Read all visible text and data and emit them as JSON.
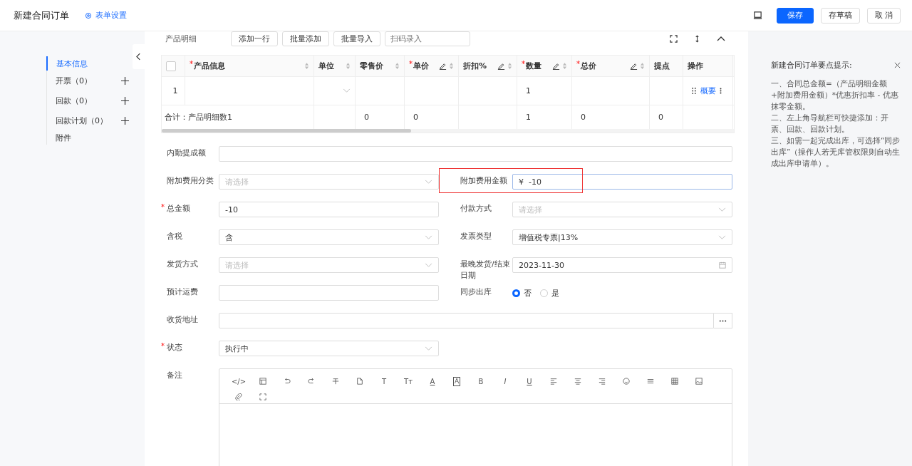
{
  "header": {
    "title": "新建合同订单",
    "settings_link": "表单设置",
    "buttons": [
      {
        "label": "保存",
        "kind": "primary"
      },
      {
        "label": "存草稿",
        "kind": "default"
      },
      {
        "label": "取 消",
        "kind": "default"
      }
    ]
  },
  "sidebar": {
    "items": [
      {
        "label": "基本信息",
        "addable": false,
        "selected": true
      },
      {
        "label": "开票",
        "count": "（0）",
        "addable": true,
        "selected": false
      },
      {
        "label": "回款",
        "count": "（0）",
        "addable": true,
        "selected": false
      },
      {
        "label": "回款计划",
        "count": "（0）",
        "addable": true,
        "selected": false
      },
      {
        "label": "附件",
        "addable": false,
        "selected": false
      }
    ]
  },
  "products": {
    "title": "产品明细",
    "select_all_checked": false,
    "buttons": [
      "添加一行",
      "批量添加",
      "批量导入"
    ],
    "scan_placeholder": "扫码录入",
    "columns": [
      {
        "label": "产品信息",
        "required": true,
        "editable": false,
        "sortable": true
      },
      {
        "label": "单位",
        "required": false,
        "editable": false,
        "sortable": true
      },
      {
        "label": "零售价",
        "required": false,
        "editable": false,
        "sortable": true
      },
      {
        "label": "单价",
        "required": true,
        "editable": true,
        "sortable": true
      },
      {
        "label": "折扣%",
        "required": false,
        "editable": true,
        "sortable": true
      },
      {
        "label": "数量",
        "required": true,
        "editable": true,
        "sortable": true
      },
      {
        "label": "总价",
        "required": true,
        "editable": true,
        "sortable": true
      },
      {
        "label": "提点",
        "required": false,
        "editable": false,
        "sortable": false
      },
      {
        "label": "操作",
        "required": false,
        "editable": false,
        "sortable": false
      }
    ],
    "rows": [
      {
        "index": "1",
        "cells": [
          "",
          "",
          "",
          "",
          "",
          "1",
          "",
          "",
          ""
        ],
        "action": "概要"
      }
    ],
    "summary": {
      "label": "合计：产品明细数1",
      "cells": [
        "",
        "0",
        "0",
        "",
        "1",
        "0",
        "0",
        ""
      ]
    }
  },
  "form": [
    {
      "label": "内勤提成额",
      "required": false,
      "kind": "text",
      "wide": true
    },
    {
      "label": "附加费用分类",
      "required": false,
      "kind": "select",
      "placeholder": "请选择"
    },
    {
      "label": "附加费用金额",
      "required": false,
      "kind": "money",
      "prefix": "¥",
      "value": "-10",
      "highlighted": true
    },
    {
      "label": "总金额",
      "required": true,
      "kind": "text",
      "value": "-10"
    },
    {
      "label": "付款方式",
      "required": false,
      "kind": "select",
      "placeholder": "请选择"
    },
    {
      "label": "含税",
      "required": false,
      "kind": "select",
      "value": "含"
    },
    {
      "label": "发票类型",
      "required": false,
      "kind": "select",
      "value": "增值税专票|13%"
    },
    {
      "label": "发货方式",
      "required": false,
      "kind": "select",
      "placeholder": "请选择"
    },
    {
      "label": "最晚发货/结束日期",
      "required": false,
      "kind": "date",
      "value": "2023-11-30"
    },
    {
      "label": "预计运费",
      "required": false,
      "kind": "text"
    },
    {
      "label": "同步出库",
      "required": false,
      "kind": "radio",
      "options": [
        {
          "label": "否",
          "selected": true
        },
        {
          "label": "是",
          "selected": false
        }
      ]
    },
    {
      "label": "收货地址",
      "required": false,
      "kind": "address",
      "wide": true
    },
    {
      "label": "状态",
      "required": true,
      "kind": "select",
      "value": "执行中"
    },
    {
      "label": "备注",
      "required": false,
      "kind": "editor",
      "wide": true
    }
  ],
  "editor_toolbar": [
    {
      "kind": "code",
      "glyph": "</>"
    },
    {
      "kind": "layout"
    },
    {
      "kind": "undo"
    },
    {
      "kind": "redo"
    },
    {
      "kind": "strike"
    },
    {
      "kind": "file"
    },
    {
      "kind": "letter",
      "glyph": "T"
    },
    {
      "kind": "letter",
      "glyph": "Tт"
    },
    {
      "kind": "underlined",
      "glyph": "A"
    },
    {
      "kind": "boxed",
      "glyph": "A"
    },
    {
      "kind": "letter",
      "glyph": "B"
    },
    {
      "kind": "italic",
      "glyph": "I"
    },
    {
      "kind": "underlined",
      "glyph": "U"
    },
    {
      "kind": "align-left"
    },
    {
      "kind": "align-center"
    },
    {
      "kind": "align-right"
    },
    {
      "kind": "emoji"
    },
    {
      "kind": "rule"
    },
    {
      "kind": "table"
    },
    {
      "kind": "image"
    },
    {
      "kind": "attach"
    },
    {
      "kind": "fullscreen"
    }
  ],
  "tips": {
    "title": "新建合同订单要点提示:",
    "lines": [
      "一、合同总金额=（产品明细金额+附加费用金额）*优惠折扣率 - 优惠抹零金额。",
      "二、左上角导航栏可快捷添加：开票、回款、回款计划。",
      "三、如需一起完成出库，可选择“同步出库”（操作人若无库管权限则自动生成出库申请单）。"
    ]
  }
}
